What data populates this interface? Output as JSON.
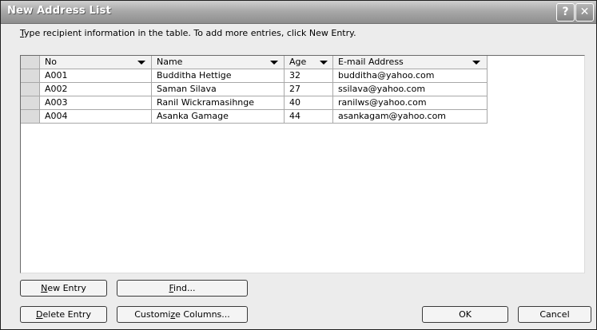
{
  "window": {
    "title": "New Address List",
    "help_glyph": "?",
    "close_glyph": "✕"
  },
  "instruction": {
    "first_letter": "T",
    "rest": "ype recipient information in the table.  To add more entries, click New Entry."
  },
  "table": {
    "columns": [
      "No",
      "Name",
      "Age",
      "E-mail Address"
    ],
    "rows": [
      {
        "no": "A001",
        "name": "Budditha Hettige",
        "age": "32",
        "email": "budditha@yahoo.com"
      },
      {
        "no": "A002",
        "name": "Saman Silava",
        "age": "27",
        "email": "ssilava@yahoo.com"
      },
      {
        "no": "A003",
        "name": "Ranil Wickramasihnge",
        "age": "40",
        "email": "ranilws@yahoo.com"
      },
      {
        "no": "A004",
        "name": "Asanka Gamage",
        "age": "44",
        "email": "asankagam@yahoo.com"
      }
    ]
  },
  "buttons": {
    "new_entry": {
      "mnemonic": "N",
      "rest": "ew Entry"
    },
    "find": {
      "mnemonic": "F",
      "rest": "ind..."
    },
    "delete_entry": {
      "mnemonic": "D",
      "rest": "elete Entry"
    },
    "customize": {
      "before": "Customi",
      "mnemonic": "z",
      "after": "e Columns..."
    },
    "ok": "OK",
    "cancel": "Cancel"
  }
}
